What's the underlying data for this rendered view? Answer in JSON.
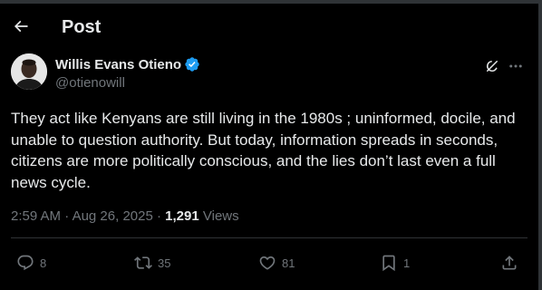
{
  "header": {
    "title": "Post",
    "back_icon": "arrow-left-icon"
  },
  "post": {
    "author_name": "Willis Evans Otieno",
    "author_handle": "@otienowill",
    "verified": true,
    "text": "They act like Kenyans are still living in the 1980s ; uninformed, docile, and unable to question authority. But today, information spreads in seconds, citizens are more politically conscious, and the lies don’t last even a full news cycle.",
    "time": "2:59 AM",
    "date": "Aug 26, 2025",
    "separator": "·",
    "views_count": "1,291",
    "views_label": "Views"
  },
  "actions": {
    "replies": "8",
    "reposts": "35",
    "likes": "81",
    "bookmarks": "1"
  },
  "colors": {
    "background": "#000000",
    "text": "#e7e9ea",
    "muted": "#71767b",
    "verified": "#1d9bf0",
    "border": "#2f3336"
  }
}
